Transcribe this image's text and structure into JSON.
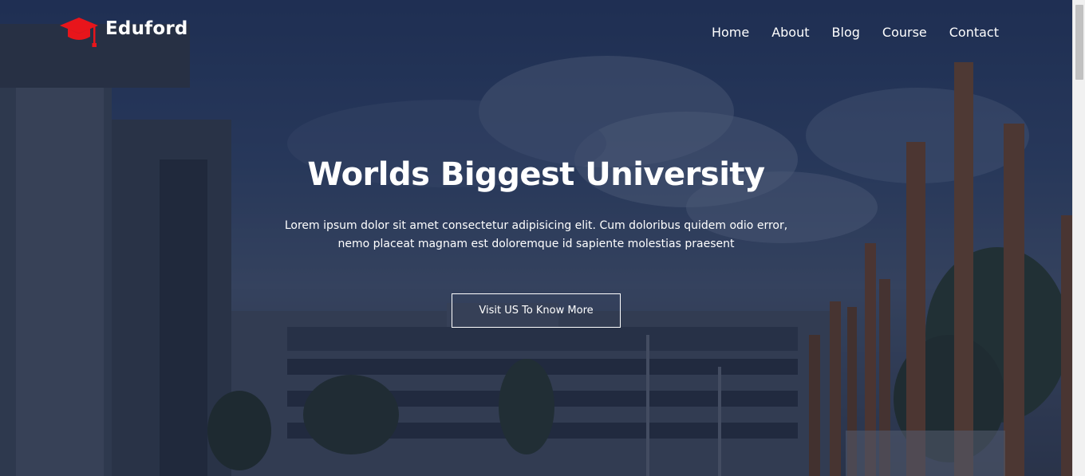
{
  "brand": {
    "name": "Eduford",
    "icon": "graduation-cap-icon",
    "icon_color": "#e8151b"
  },
  "nav": {
    "items": [
      {
        "label": "Home"
      },
      {
        "label": "About"
      },
      {
        "label": "Blog"
      },
      {
        "label": "Course"
      },
      {
        "label": "Contact"
      }
    ]
  },
  "hero": {
    "title": "Worlds Biggest University",
    "text": "Lorem ipsum dolor sit amet consectetur adipisicing elit. Cum doloribus quidem odio error, nemo placeat magnam est doloremque id sapiente molestias praesent",
    "button_label": "Visit US To Know More",
    "text_color": "#ffffff"
  },
  "colors": {
    "overlay": "#121c3c",
    "accent": "#e8151b"
  }
}
